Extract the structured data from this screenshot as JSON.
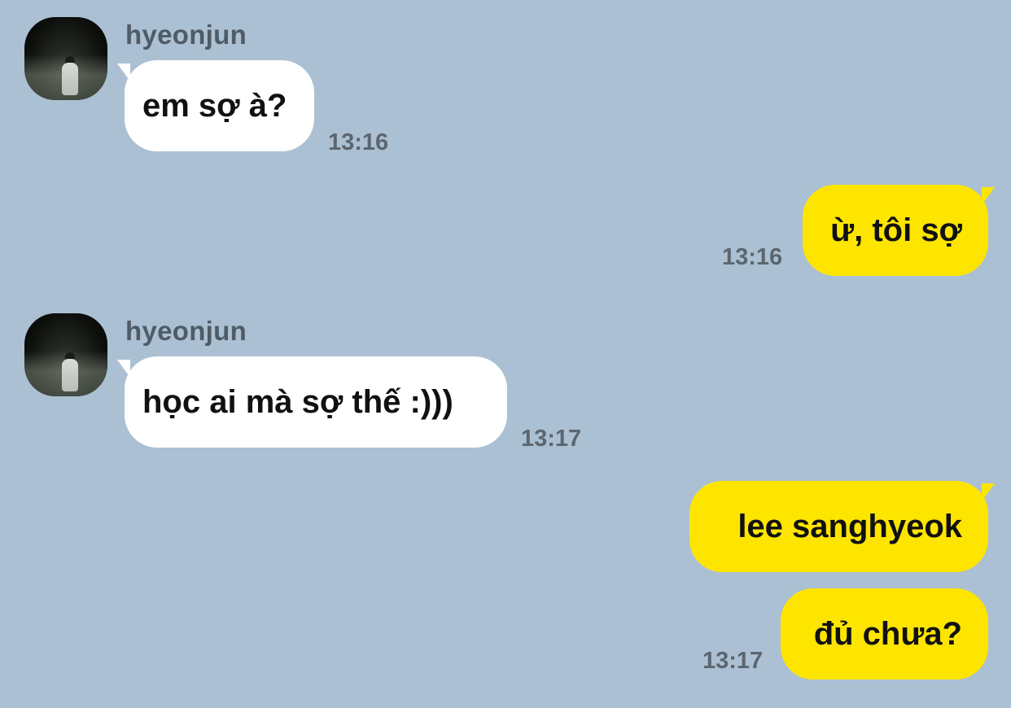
{
  "messages": [
    {
      "sender": "hyeonjun",
      "text": "em sợ à?",
      "time": "13:16"
    },
    {
      "text": "ừ, tôi sợ",
      "time": "13:16"
    },
    {
      "sender": "hyeonjun",
      "text": "học ai mà sợ thế :)))",
      "time": "13:17"
    },
    {
      "text": "lee sanghyeok"
    },
    {
      "text": "đủ chưa?",
      "time": "13:17"
    }
  ],
  "colors": {
    "background": "#abc0d2",
    "incoming_bubble": "#ffffff",
    "outgoing_bubble": "#fee500",
    "timestamp": "#5b6670",
    "sender_name": "#4f5b66"
  }
}
